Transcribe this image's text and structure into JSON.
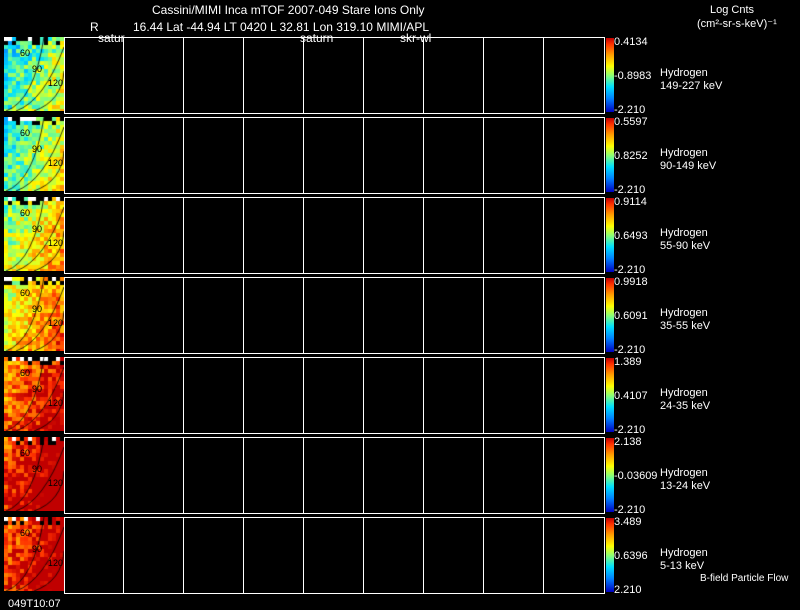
{
  "header": {
    "title": "Cassini/MIMI Inca mTOF  2007-049   Stare    Ions Only",
    "r_label": "R",
    "ephemeris": "16.44 Lat -44.94 LT 0420 L         32.81 Lon         319.10  MIMI/APL",
    "saturn_left": "satur",
    "saturn_mid": "saturn",
    "sky_label": "skr-wl",
    "units_line1": "Log Cnts",
    "units_line2": "(cm²-sr-s-keV)⁻¹"
  },
  "thumb_labels": [
    "60",
    "90",
    "120"
  ],
  "panels": [
    {
      "species": "Hydrogen",
      "energy": "149-227 keV",
      "max": "0.4134",
      "mid": "-0.8983",
      "min": "-2.210"
    },
    {
      "species": "Hydrogen",
      "energy": "90-149 keV",
      "max": "0.5597",
      "mid": "0.8252",
      "min": "-2.210"
    },
    {
      "species": "Hydrogen",
      "energy": "55-90 keV",
      "max": "0.9114",
      "mid": "0.6493",
      "min": "-2.210"
    },
    {
      "species": "Hydrogen",
      "energy": "35-55 keV",
      "max": "0.9918",
      "mid": "0.6091",
      "min": "-2.210"
    },
    {
      "species": "Hydrogen",
      "energy": "24-35 keV",
      "max": "1.389",
      "mid": "0.4107",
      "min": "-2.210"
    },
    {
      "species": "Hydrogen",
      "energy": "13-24 keV",
      "max": "2.138",
      "mid": "-0.03609",
      "min": "-2.210"
    },
    {
      "species": "Hydrogen",
      "energy": "5-13 keV",
      "max": "3.489",
      "mid": "0.6396",
      "min": "2.210"
    }
  ],
  "footer": {
    "timestamp": "049T10:07",
    "flow_label": "B-field Particle Flow"
  }
}
